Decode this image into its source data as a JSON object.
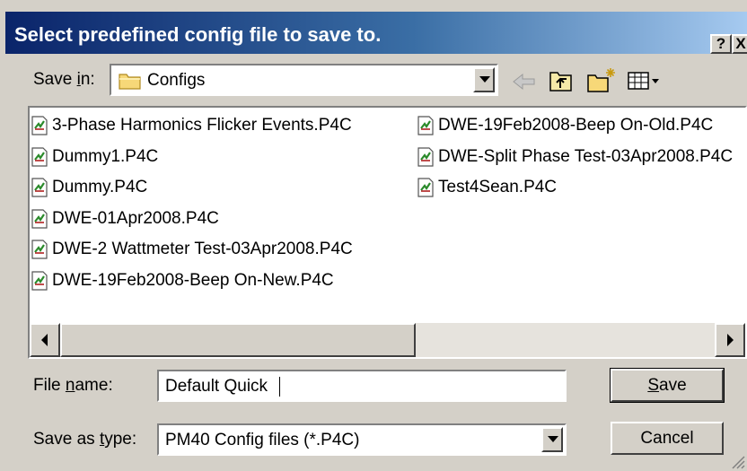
{
  "title": "Select predefined config file to save to.",
  "titlebar_buttons": {
    "help": "?",
    "close": "X"
  },
  "save_in": {
    "label_pre": "Save ",
    "label_key": "i",
    "label_post": "n:",
    "value": "Configs"
  },
  "files": [
    "3-Phase Harmonics Flicker Events.P4C",
    "Dummy1.P4C",
    "Dummy.P4C",
    "DWE-01Apr2008.P4C",
    "DWE-2 Wattmeter Test-03Apr2008.P4C",
    "DWE-19Feb2008-Beep On-New.P4C",
    "DWE-19Feb2008-Beep On-Old.P4C",
    "DWE-Split Phase Test-03Apr2008.P4C",
    "Test4Sean.P4C"
  ],
  "file_name": {
    "label_pre": "File ",
    "label_key": "n",
    "label_post": "ame:",
    "value": "Default Quick"
  },
  "save_as_type": {
    "label_pre": "Save as ",
    "label_key": "t",
    "label_post": "ype:",
    "value": "PM40 Config files (*.P4C)"
  },
  "buttons": {
    "save_key": "S",
    "save_rest": "ave",
    "cancel": "Cancel"
  }
}
